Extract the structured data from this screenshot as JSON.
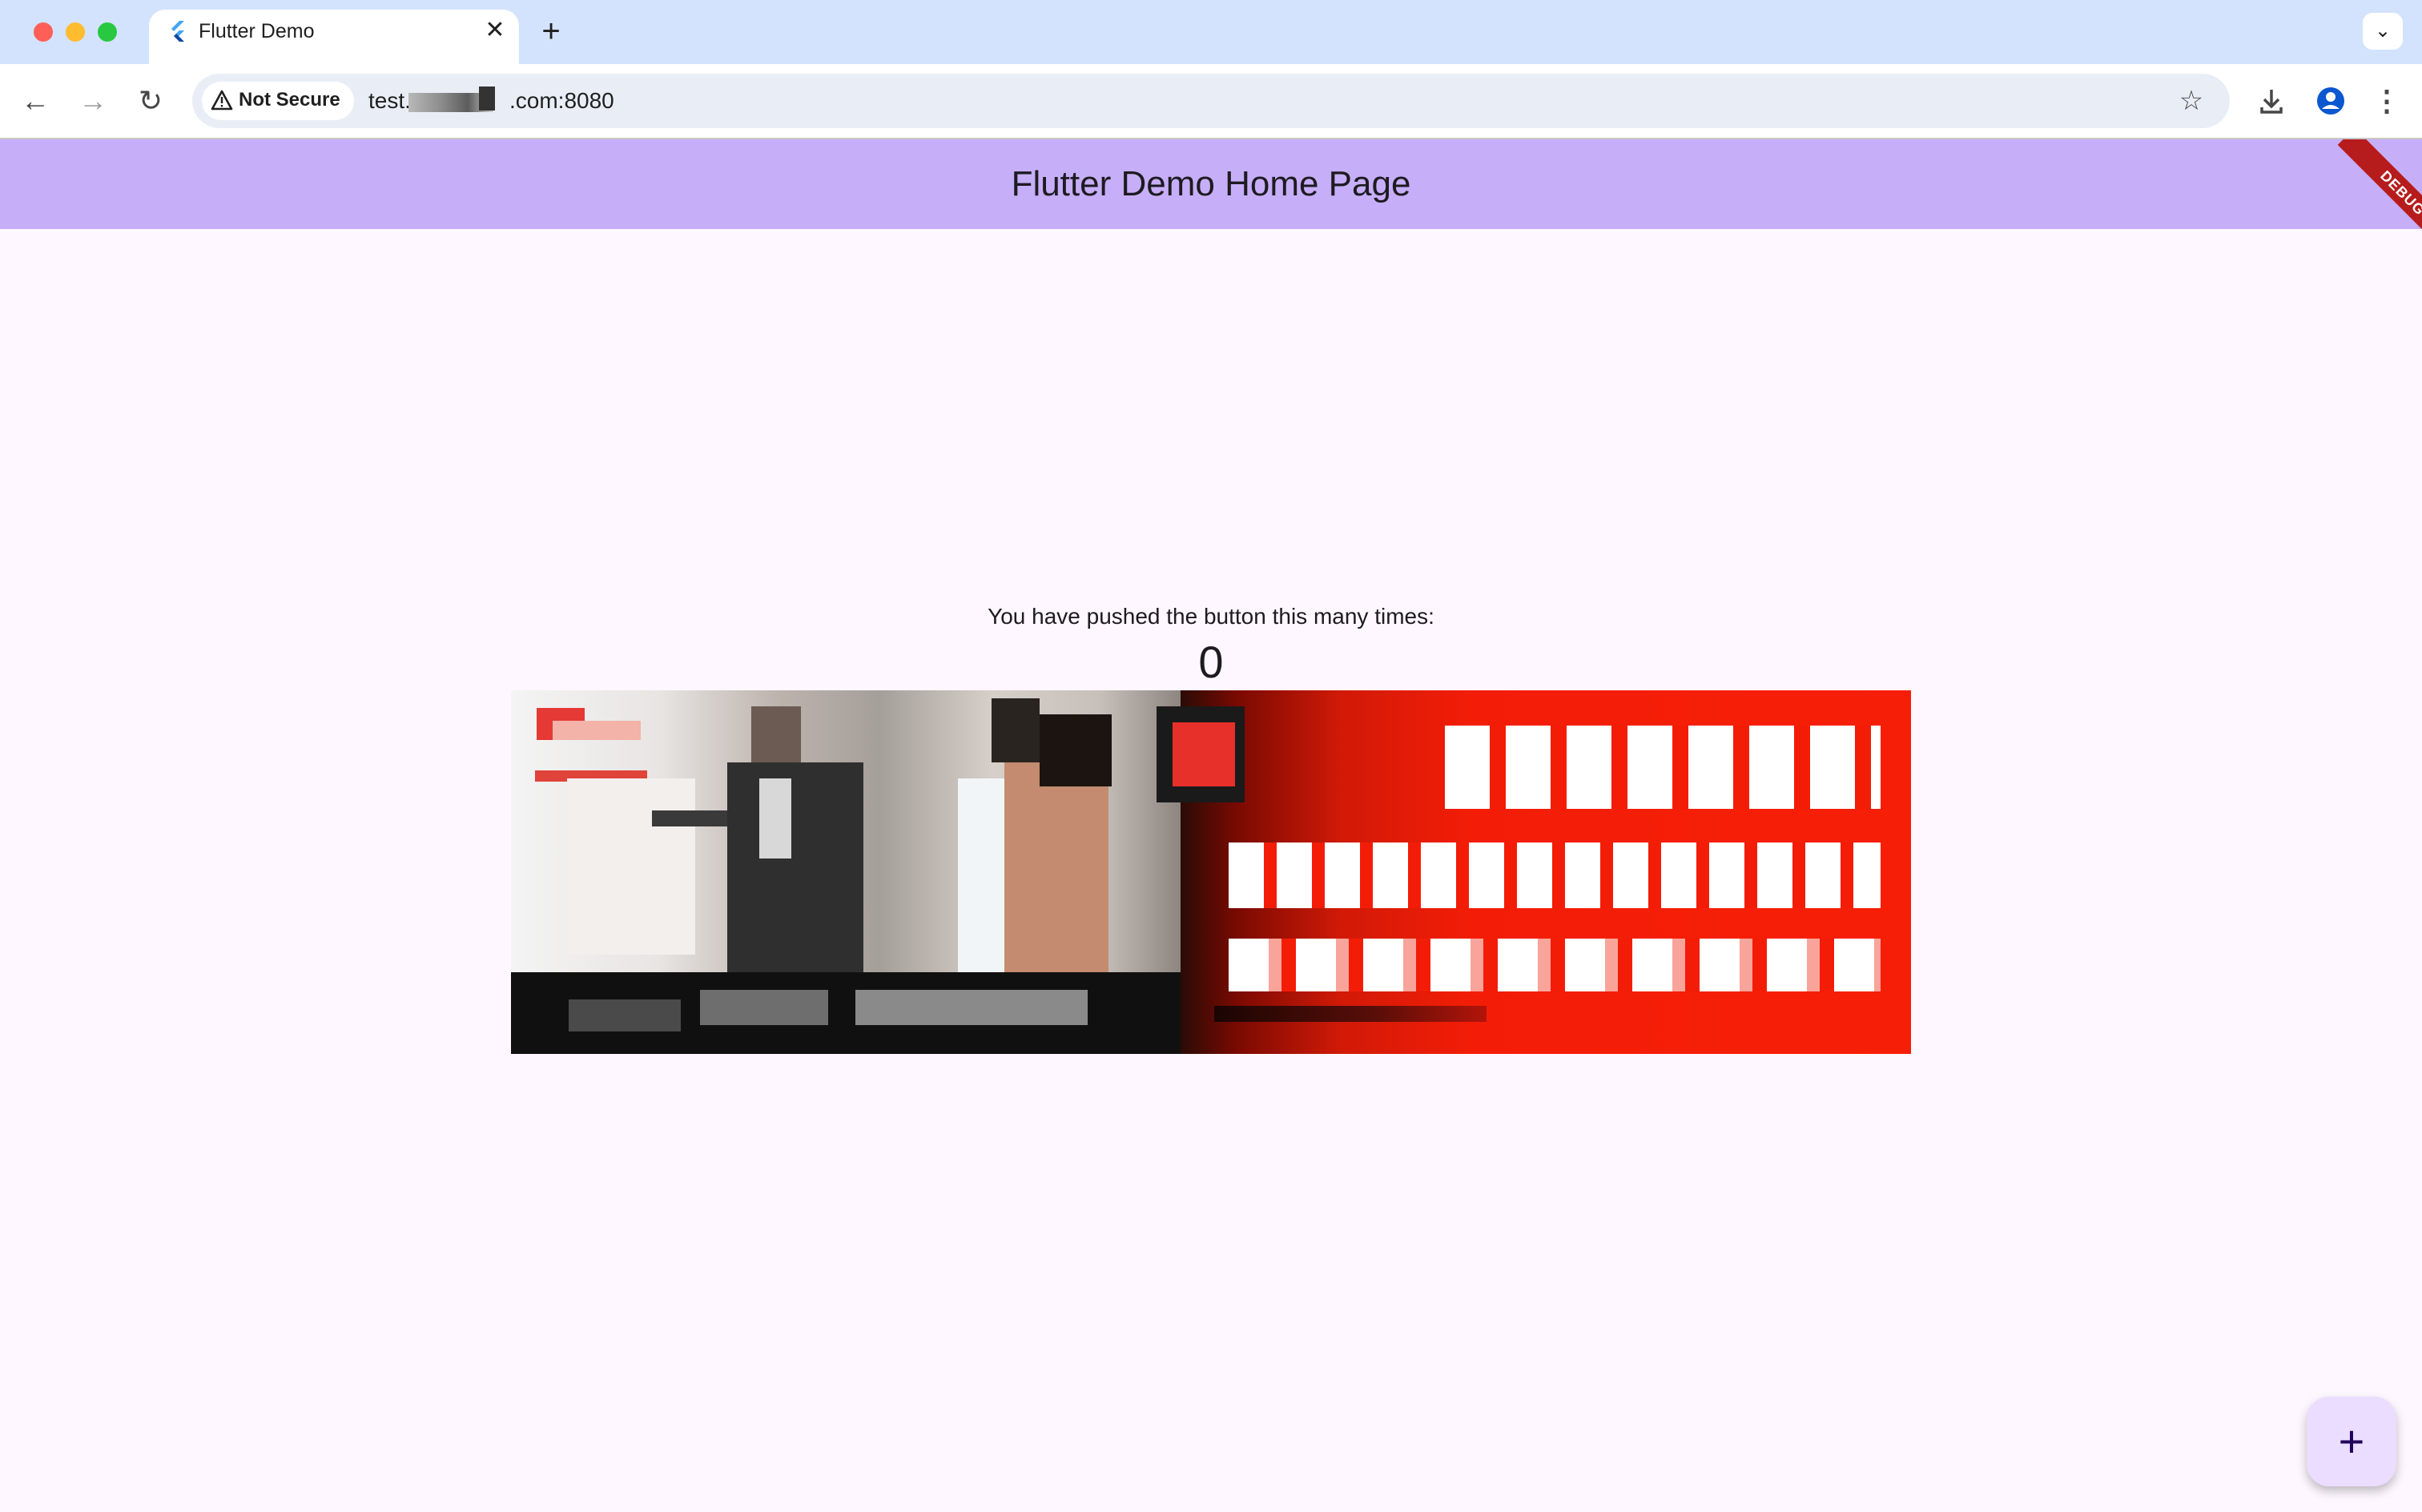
{
  "browser": {
    "tab_title": "Flutter Demo",
    "tab_close": "✕",
    "new_tab": "+",
    "tab_menu": "⌄",
    "security_label": "Not Secure",
    "url_prefix": "test.",
    "url_suffix": ".com:8080",
    "nav": {
      "back": "←",
      "forward": "→",
      "reload": "↻"
    },
    "star": "☆",
    "menu": "⋮"
  },
  "app": {
    "title": "Flutter Demo Home Page",
    "debug_banner": "DEBUG",
    "counter_label": "You have pushed the button this many times:",
    "counter_value": "0",
    "fab_label": "+"
  },
  "colors": {
    "appbar": "#c7aef9",
    "background": "#fef7ff",
    "fab": "#eaddff",
    "debug": "#b71c1c"
  }
}
